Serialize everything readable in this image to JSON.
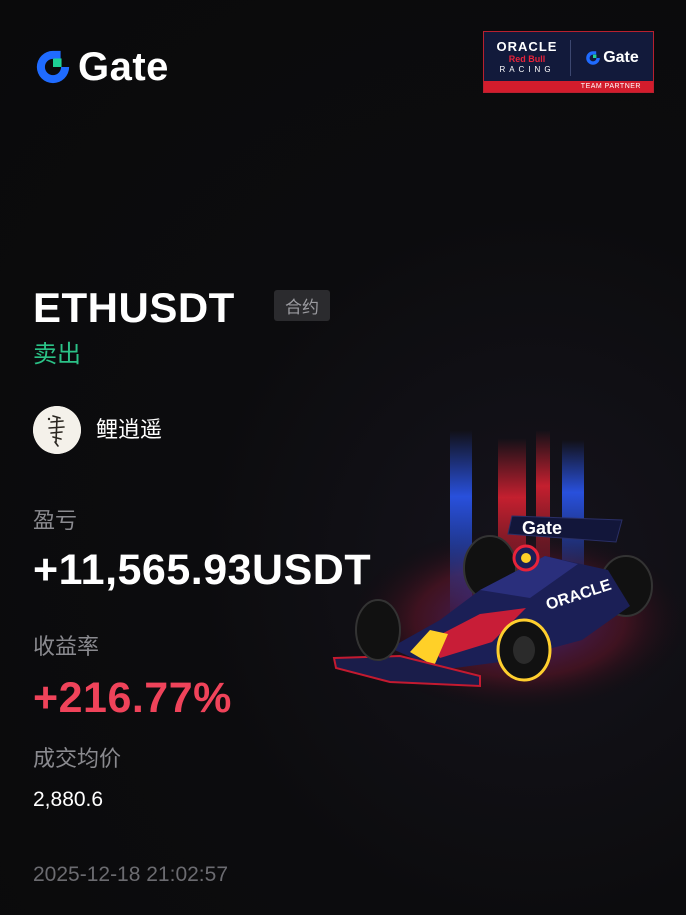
{
  "brand": {
    "name": "Gate",
    "accent_blue": "#1f6bff",
    "accent_green": "#1ed196"
  },
  "partner_badge": {
    "line1": "ORACLE",
    "line2": "Red Bull",
    "line3": "RACING",
    "gate_label": "Gate",
    "footer": "TEAM PARTNER"
  },
  "trade": {
    "symbol": "ETHUSDT",
    "contract_tag": "合约",
    "side": "卖出",
    "side_color": "#2bc287"
  },
  "user": {
    "name": "鲤逍遥",
    "avatar_icon": "calligraphy-avatar-icon"
  },
  "stats": {
    "pnl_label": "盈亏",
    "pnl_value": "+11,565.93USDT",
    "roi_label": "收益率",
    "roi_value": "+216.77%",
    "roi_color": "#f0435a",
    "avg_price_label": "成交均价",
    "avg_price_value": "2,880.6"
  },
  "timestamp": "2025-12-18 21:02:57",
  "car_graphic": {
    "icon": "f1-race-car-icon",
    "wing_text": "Gate",
    "sidepod_text": "ORACLE"
  }
}
